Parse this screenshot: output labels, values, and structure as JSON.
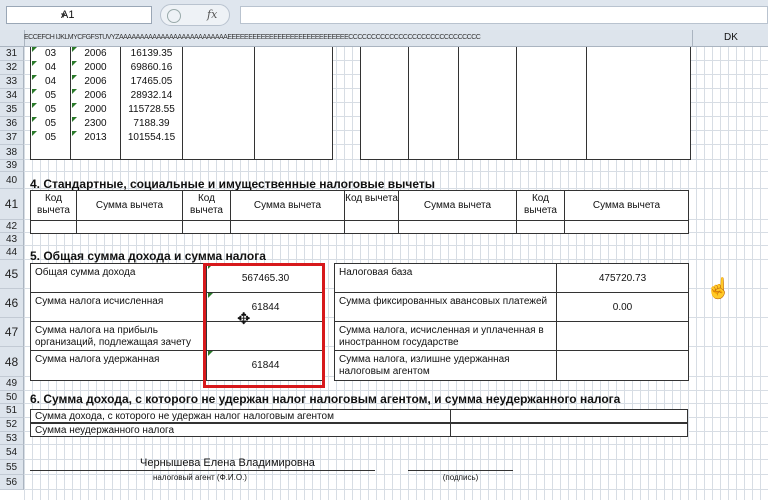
{
  "name_box": {
    "value": "A1",
    "dropdown": "▾"
  },
  "formula_bar": {
    "fx": "fx",
    "value": ""
  },
  "column_header": {
    "letters": "ECCEFCH IJKLMYCFGFSTUVYZAAAAAAAAAAAAAAAAAAAAAAAAAAEEEEEEEEEEEEEEEEEEEEEEEEEEEEECCCCCCCCCCCCCCCCCCCCCCCCCCCCC",
    "last_col": "DK"
  },
  "row_numbers": [
    "31",
    "32",
    "33",
    "34",
    "35",
    "36",
    "37",
    "38",
    "39",
    "40",
    "41",
    "42",
    "43",
    "44",
    "45",
    "46",
    "47",
    "48",
    "49",
    "50",
    "51",
    "52",
    "53",
    "54",
    "55",
    "56"
  ],
  "top_table": [
    {
      "code": "03",
      "tax": "2006",
      "amount": "16139.35"
    },
    {
      "code": "04",
      "tax": "2000",
      "amount": "69860.16"
    },
    {
      "code": "04",
      "tax": "2006",
      "amount": "17465.05"
    },
    {
      "code": "05",
      "tax": "2006",
      "amount": "28932.14"
    },
    {
      "code": "05",
      "tax": "2000",
      "amount": "115728.55"
    },
    {
      "code": "05",
      "tax": "2300",
      "amount": "7188.39"
    },
    {
      "code": "05",
      "tax": "2013",
      "amount": "101554.15"
    }
  ],
  "section4": {
    "title": "4. Стандартные, социальные и имущественные налоговые вычеты",
    "code_header": "Код вычета",
    "sum_header": "Сумма вычета"
  },
  "section5": {
    "title": "5. Общая сумма дохода и сумма налога",
    "rows": [
      {
        "label": "Общая сумма дохода",
        "value": "567465.30",
        "label2": "Налоговая база",
        "value2": "475720.73"
      },
      {
        "label": "Сумма налога исчисленная",
        "value": "61844",
        "label2": "Сумма фиксированных авансовых платежей",
        "value2": "0.00"
      },
      {
        "label": "Сумма налога на прибыль организаций, подлежащая зачету",
        "value": "",
        "label2": "Сумма налога, исчисленная и уплаченная в иностранном государстве",
        "value2": ""
      },
      {
        "label": "Сумма налога удержанная",
        "value": "61844",
        "label2": "Сумма налога, излишне удержанная налоговым агентом",
        "value2": ""
      }
    ]
  },
  "section6": {
    "title": "6. Сумма дохода, с которого не удержан налог налоговым агентом, и сумма неудержанного налога",
    "row1": "Сумма дохода, с которого не удержан налог налоговым агентом",
    "row2": "Сумма неудержанного налога"
  },
  "signature": {
    "name": "Чернышева Елена Владимировна",
    "agent_caption": "налоговый агент (Ф.И.О.)",
    "sign_caption": "(подпись)"
  },
  "colors": {
    "highlight": "#d7191c",
    "header_bg": "#dde4ec"
  }
}
